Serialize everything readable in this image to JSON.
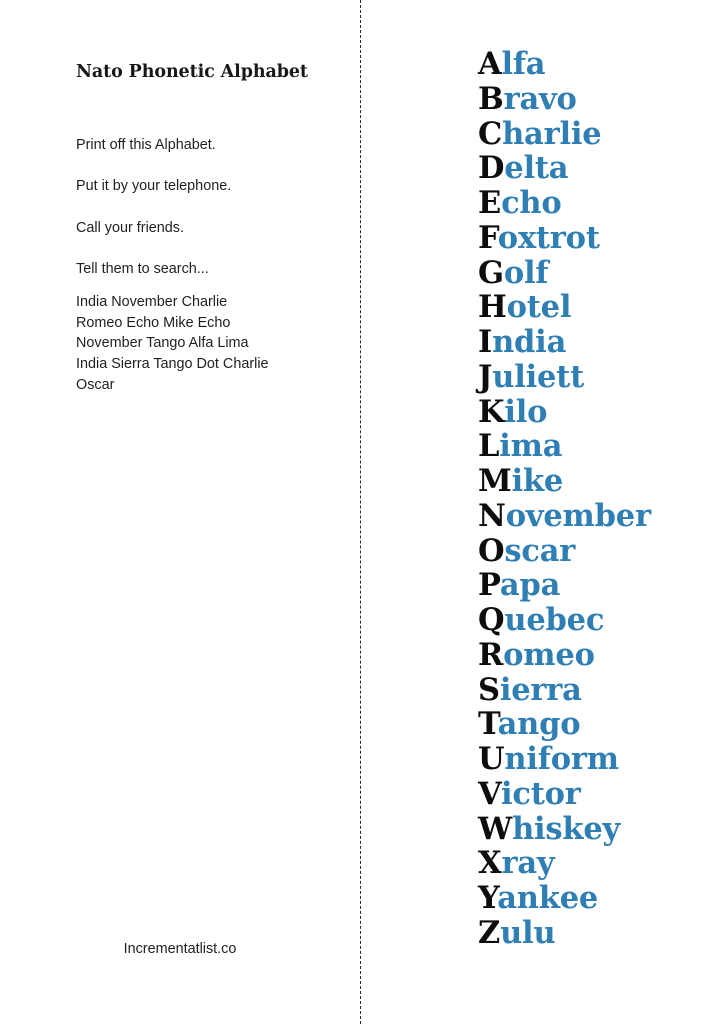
{
  "document": {
    "title": "Nato Phonetic Alphabet",
    "footer_url": "Incrementatlist.co",
    "background_color": "#ffffff",
    "accent_color": "#2f7fb4",
    "initial_letter_color": "#0d0d0d",
    "body_text_color": "#231f20",
    "divider": {
      "name": "fold-line",
      "style": "dashed",
      "orientation": "vertical",
      "color": "#2b2b2b"
    }
  },
  "left_panel": {
    "heading": "Nato Phonetic Alphabet",
    "instructions": [
      "Print off this Alphabet.",
      "Put it by your telephone.",
      "Call your friends.",
      "Tell them to search..."
    ],
    "spelled_url_lines": [
      "India November Charlie",
      "Romeo Echo Mike Echo",
      "November Tango Alfa Lima",
      "India Sierra Tango Dot Charlie",
      "Oscar"
    ],
    "footer": "Incrementatlist.co"
  },
  "alphabet": {
    "items": [
      {
        "letter": "A",
        "rest": "lfa",
        "word": "Alfa"
      },
      {
        "letter": "B",
        "rest": "ravo",
        "word": "Bravo"
      },
      {
        "letter": "C",
        "rest": "harlie",
        "word": "Charlie"
      },
      {
        "letter": "D",
        "rest": "elta",
        "word": "Delta"
      },
      {
        "letter": "E",
        "rest": "cho",
        "word": "Echo"
      },
      {
        "letter": "F",
        "rest": "oxtrot",
        "word": "Foxtrot"
      },
      {
        "letter": "G",
        "rest": "olf",
        "word": "Golf"
      },
      {
        "letter": "H",
        "rest": "otel",
        "word": "Hotel"
      },
      {
        "letter": "I",
        "rest": "ndia",
        "word": "India"
      },
      {
        "letter": "J",
        "rest": "uliett",
        "word": "Juliett"
      },
      {
        "letter": "K",
        "rest": "ilo",
        "word": "Kilo"
      },
      {
        "letter": "L",
        "rest": "ima",
        "word": "Lima"
      },
      {
        "letter": "M",
        "rest": "ike",
        "word": "Mike"
      },
      {
        "letter": "N",
        "rest": "ovember",
        "word": "November"
      },
      {
        "letter": "O",
        "rest": "scar",
        "word": "Oscar"
      },
      {
        "letter": "P",
        "rest": "apa",
        "word": "Papa"
      },
      {
        "letter": "Q",
        "rest": "uebec",
        "word": "Quebec"
      },
      {
        "letter": "R",
        "rest": "omeo",
        "word": "Romeo"
      },
      {
        "letter": "S",
        "rest": "ierra",
        "word": "Sierra"
      },
      {
        "letter": "T",
        "rest": "ango",
        "word": "Tango"
      },
      {
        "letter": "U",
        "rest": "niform",
        "word": "Uniform"
      },
      {
        "letter": "V",
        "rest": "ictor",
        "word": "Victor"
      },
      {
        "letter": "W",
        "rest": "hiskey",
        "word": "Whiskey"
      },
      {
        "letter": "X",
        "rest": "ray",
        "word": "Xray"
      },
      {
        "letter": "Y",
        "rest": "ankee",
        "word": "Yankee"
      },
      {
        "letter": "Z",
        "rest": "ulu",
        "word": "Zulu"
      }
    ]
  }
}
